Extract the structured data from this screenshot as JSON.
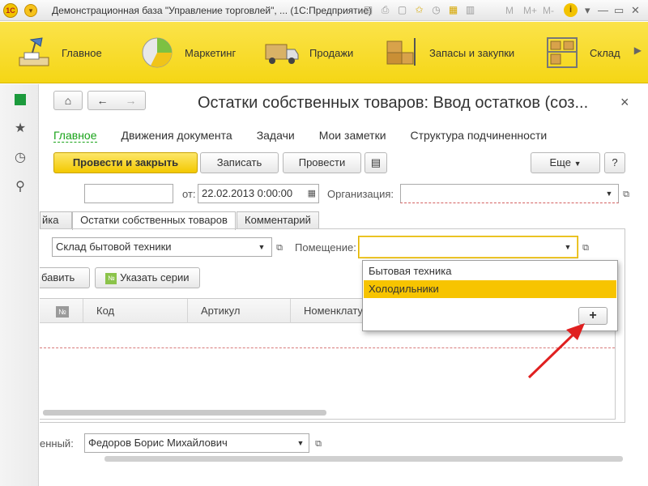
{
  "window": {
    "title": "Демонстрационная база \"Управление торговлей\", ...  (1С:Предприятие)",
    "logo": "1С",
    "m_labels": [
      "M",
      "M+",
      "M-"
    ],
    "icons": [
      "save-icon",
      "print-icon",
      "preview-icon",
      "favorites-icon",
      "history-icon",
      "calendar-icon",
      "calculator-icon"
    ]
  },
  "sections": [
    {
      "name": "main",
      "label": "Главное"
    },
    {
      "name": "marketing",
      "label": "Маркетинг"
    },
    {
      "name": "sales",
      "label": "Продажи"
    },
    {
      "name": "stock",
      "label": "Запасы и закупки"
    },
    {
      "name": "warehouse",
      "label": "Склад"
    }
  ],
  "form": {
    "title": "Остатки собственных товаров: Ввод остатков (соз...",
    "close": "×",
    "links": [
      "Главное",
      "Движения документа",
      "Задачи",
      "Мои заметки",
      "Структура подчиненности"
    ],
    "buttons": {
      "post_close": "Провести и закрыть",
      "write": "Записать",
      "post": "Провести",
      "more": "Еще",
      "help": "?"
    },
    "date_label": "от:",
    "date_value": "22.02.2013  0:00:00",
    "org_label": "Организация:",
    "org_value": "",
    "number_value": ""
  },
  "tabs": [
    {
      "label": "йка",
      "active": false
    },
    {
      "label": "Остатки собственных товаров",
      "active": true
    },
    {
      "label": "Комментарий",
      "active": false
    }
  ],
  "tab_content": {
    "warehouse_value": "Склад бытовой техники",
    "room_label": "Помещение:",
    "room_value": "",
    "add_button": "бавить",
    "series_button": "Указать серии",
    "columns": [
      "№",
      "Код",
      "Артикул",
      "Номенклату"
    ]
  },
  "popup": {
    "items": [
      "Бытовая техника",
      "Холодильники"
    ],
    "selected_index": 1,
    "add_label": "+"
  },
  "footer": {
    "responsible_label": "енный:",
    "responsible_value": "Федоров Борис Михайлович"
  },
  "colors": {
    "accent": "#f7c400",
    "link_active": "#19a319",
    "arrow": "#e02020"
  }
}
